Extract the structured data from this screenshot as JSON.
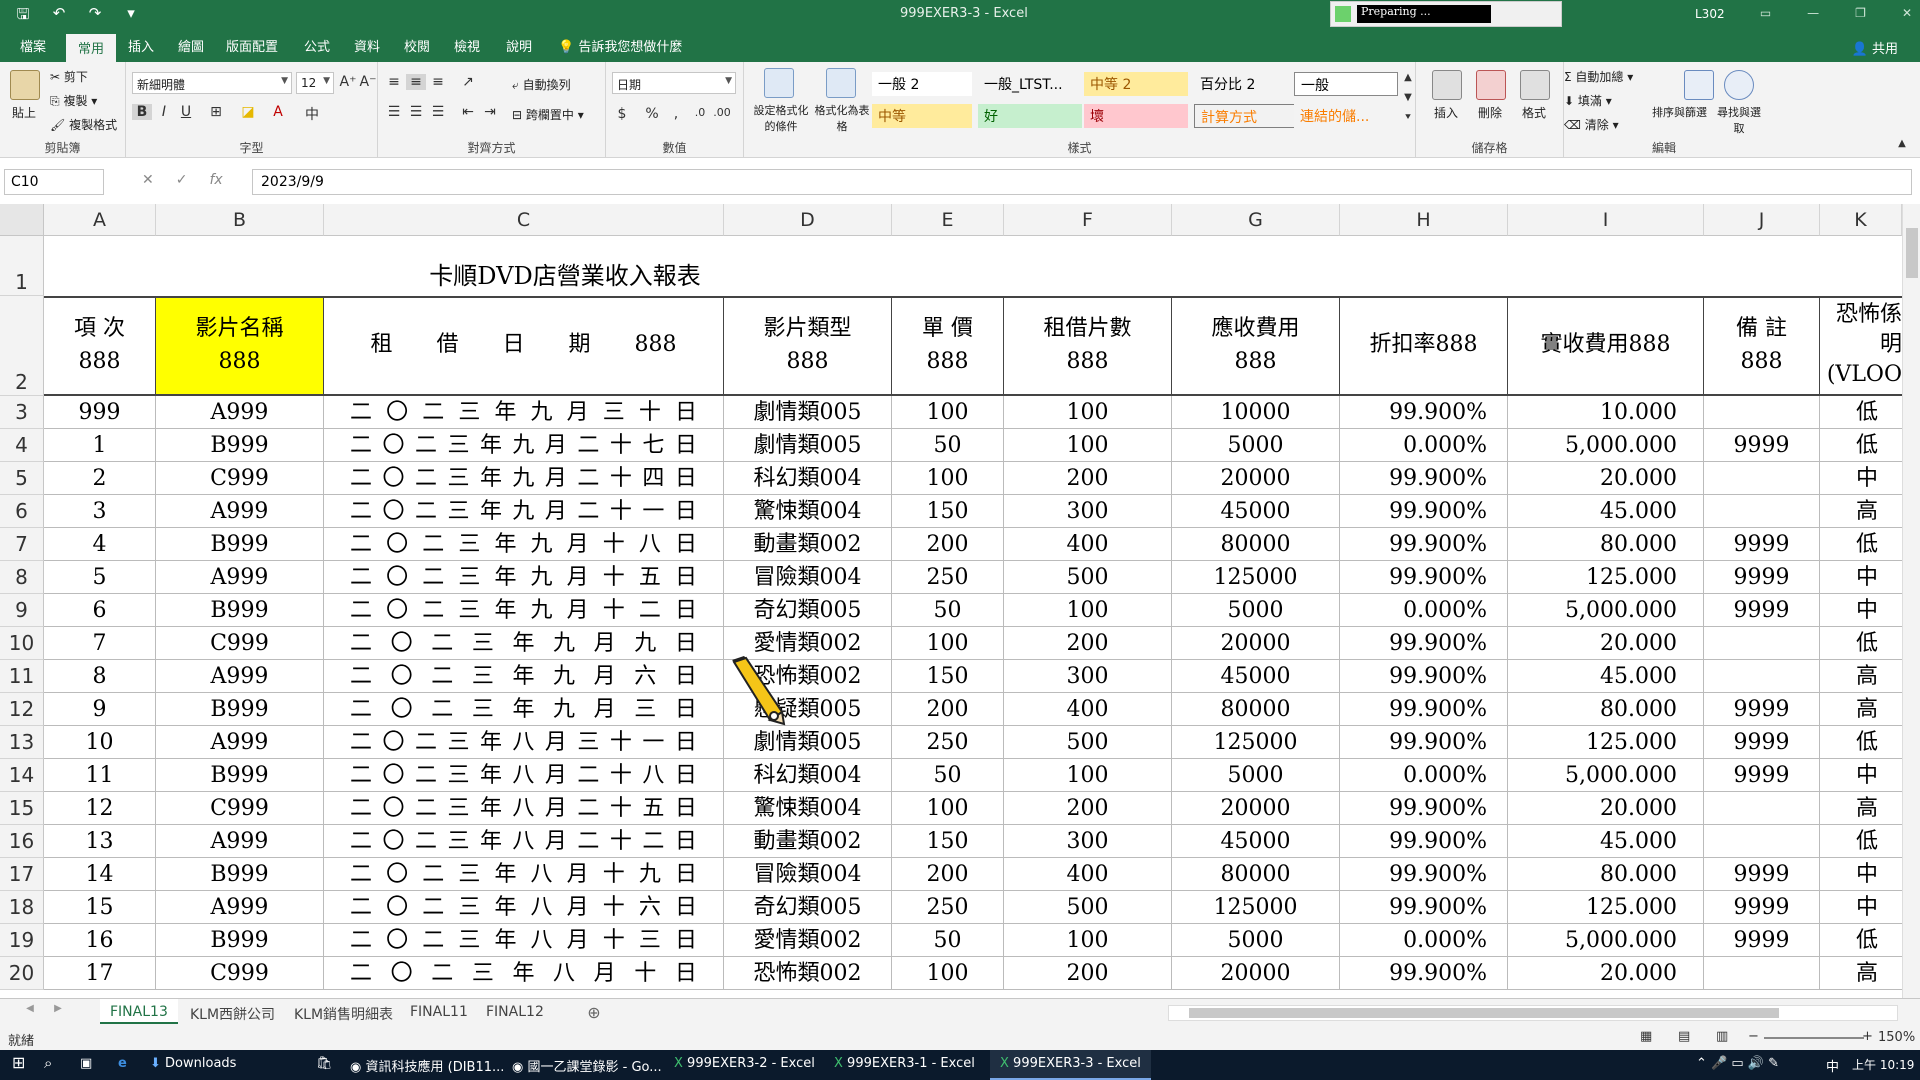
{
  "window": {
    "title": "999EXER3-3 - Excel",
    "user": "L302",
    "progress_text": "Preparing ...",
    "share": "共用"
  },
  "qat": {
    "save": "🖫",
    "undo": "↶",
    "redo": "↷",
    "customize": "▾"
  },
  "tabs": [
    "檔案",
    "常用",
    "插入",
    "繪圖",
    "版面配置",
    "公式",
    "資料",
    "校閱",
    "檢視",
    "說明"
  ],
  "tell_me": "告訴我您想做什麼",
  "ribbon": {
    "clipboard": {
      "label": "剪貼簿",
      "paste": "貼上",
      "cut": "剪下",
      "copy": "複製",
      "format_painter": "複製格式"
    },
    "font": {
      "label": "字型",
      "name": "新細明體",
      "size": "12"
    },
    "alignment": {
      "label": "對齊方式",
      "wrap": "自動換列",
      "merge": "跨欄置中"
    },
    "number": {
      "label": "數值",
      "format": "日期"
    },
    "styles": {
      "label": "樣式",
      "cond_format": "設定格式化的條件",
      "format_table": "格式化為表格",
      "cells": [
        {
          "text": "一般 2",
          "bg": "#ffffff",
          "fg": "#000000"
        },
        {
          "text": "一般_LTST...",
          "bg": "#f3f3f3",
          "fg": "#000000"
        },
        {
          "text": "中等 2",
          "bg": "#ffeb9c",
          "fg": "#9c5700"
        },
        {
          "text": "百分比 2",
          "bg": "#f3f3f3",
          "fg": "#000000"
        },
        {
          "text": "一般",
          "bg": "#ffffff",
          "fg": "#000000"
        },
        {
          "text": "中等",
          "bg": "#ffeb9c",
          "fg": "#9c5700"
        },
        {
          "text": "好",
          "bg": "#c6efce",
          "fg": "#006100"
        },
        {
          "text": "壞",
          "bg": "#ffc7ce",
          "fg": "#9c0006"
        },
        {
          "text": "計算方式",
          "bg": "#f2f2f2",
          "fg": "#fa7d00"
        },
        {
          "text": "連結的儲...",
          "bg": "#f3f3f3",
          "fg": "#fa7d00"
        }
      ]
    },
    "cells": {
      "label": "儲存格",
      "insert": "插入",
      "delete": "刪除",
      "format": "格式"
    },
    "editing": {
      "label": "編輯",
      "autosum": "自動加總",
      "fill": "填滿",
      "clear": "清除",
      "sort": "排序與篩選",
      "find": "尋找與選取"
    }
  },
  "formula_bar": {
    "name_box": "C10",
    "value": "2023/9/9",
    "fx": "fx"
  },
  "columns": [
    "A",
    "B",
    "C",
    "D",
    "E",
    "F",
    "G",
    "H",
    "I",
    "J",
    "K"
  ],
  "sheet": {
    "title": "卡順DVD店營業收入報表",
    "headers": [
      {
        "col": "A",
        "text": "項 次\n888"
      },
      {
        "col": "B",
        "text": "影片名稱\n888"
      },
      {
        "col": "C",
        "text": "租　　借　　日　　期　　888"
      },
      {
        "col": "D",
        "text": "影片類型\n888"
      },
      {
        "col": "E",
        "text": "單 價\n888"
      },
      {
        "col": "F",
        "text": "租借片數\n888"
      },
      {
        "col": "G",
        "text": "應收費用\n888"
      },
      {
        "col": "H",
        "text": "折扣率888"
      },
      {
        "col": "I",
        "text": "實收費用888"
      },
      {
        "col": "J",
        "text": "備 註\n888"
      },
      {
        "col": "K",
        "text": "恐怖係\n明\n(VLOO"
      }
    ],
    "rows": [
      {
        "n": "3",
        "a": "999",
        "b": "A999",
        "c": "二〇二三年九月三十日",
        "d": "劇情類005",
        "e": "100",
        "f": "100",
        "g": "10000",
        "h": "99.900%",
        "i": "10.000",
        "j": "",
        "k": "低"
      },
      {
        "n": "4",
        "a": "1",
        "b": "B999",
        "c": "二〇二三年九月二十七日",
        "d": "劇情類005",
        "e": "50",
        "f": "100",
        "g": "5000",
        "h": "0.000%",
        "i": "5,000.000",
        "j": "9999",
        "k": "低"
      },
      {
        "n": "5",
        "a": "2",
        "b": "C999",
        "c": "二〇二三年九月二十四日",
        "d": "科幻類004",
        "e": "100",
        "f": "200",
        "g": "20000",
        "h": "99.900%",
        "i": "20.000",
        "j": "",
        "k": "中"
      },
      {
        "n": "6",
        "a": "3",
        "b": "A999",
        "c": "二〇二三年九月二十一日",
        "d": "驚悚類004",
        "e": "150",
        "f": "300",
        "g": "45000",
        "h": "99.900%",
        "i": "45.000",
        "j": "",
        "k": "高"
      },
      {
        "n": "7",
        "a": "4",
        "b": "B999",
        "c": "二〇二三年九月十八日",
        "d": "動畫類002",
        "e": "200",
        "f": "400",
        "g": "80000",
        "h": "99.900%",
        "i": "80.000",
        "j": "9999",
        "k": "低"
      },
      {
        "n": "8",
        "a": "5",
        "b": "A999",
        "c": "二〇二三年九月十五日",
        "d": "冒險類004",
        "e": "250",
        "f": "500",
        "g": "125000",
        "h": "99.900%",
        "i": "125.000",
        "j": "9999",
        "k": "中"
      },
      {
        "n": "9",
        "a": "6",
        "b": "B999",
        "c": "二〇二三年九月十二日",
        "d": "奇幻類005",
        "e": "50",
        "f": "100",
        "g": "5000",
        "h": "0.000%",
        "i": "5,000.000",
        "j": "9999",
        "k": "中"
      },
      {
        "n": "10",
        "a": "7",
        "b": "C999",
        "c": "二〇二三年九月九日",
        "d": "愛情類002",
        "e": "100",
        "f": "200",
        "g": "20000",
        "h": "99.900%",
        "i": "20.000",
        "j": "",
        "k": "低"
      },
      {
        "n": "11",
        "a": "8",
        "b": "A999",
        "c": "二〇二三年九月六日",
        "d": "恐怖類002",
        "e": "150",
        "f": "300",
        "g": "45000",
        "h": "99.900%",
        "i": "45.000",
        "j": "",
        "k": "高"
      },
      {
        "n": "12",
        "a": "9",
        "b": "B999",
        "c": "二〇二三年九月三日",
        "d": "懸疑類005",
        "e": "200",
        "f": "400",
        "g": "80000",
        "h": "99.900%",
        "i": "80.000",
        "j": "9999",
        "k": "高"
      },
      {
        "n": "13",
        "a": "10",
        "b": "A999",
        "c": "二〇二三年八月三十一日",
        "d": "劇情類005",
        "e": "250",
        "f": "500",
        "g": "125000",
        "h": "99.900%",
        "i": "125.000",
        "j": "9999",
        "k": "低"
      },
      {
        "n": "14",
        "a": "11",
        "b": "B999",
        "c": "二〇二三年八月二十八日",
        "d": "科幻類004",
        "e": "50",
        "f": "100",
        "g": "5000",
        "h": "0.000%",
        "i": "5,000.000",
        "j": "9999",
        "k": "中"
      },
      {
        "n": "15",
        "a": "12",
        "b": "C999",
        "c": "二〇二三年八月二十五日",
        "d": "驚悚類004",
        "e": "100",
        "f": "200",
        "g": "20000",
        "h": "99.900%",
        "i": "20.000",
        "j": "",
        "k": "高"
      },
      {
        "n": "16",
        "a": "13",
        "b": "A999",
        "c": "二〇二三年八月二十二日",
        "d": "動畫類002",
        "e": "150",
        "f": "300",
        "g": "45000",
        "h": "99.900%",
        "i": "45.000",
        "j": "",
        "k": "低"
      },
      {
        "n": "17",
        "a": "14",
        "b": "B999",
        "c": "二〇二三年八月十九日",
        "d": "冒險類004",
        "e": "200",
        "f": "400",
        "g": "80000",
        "h": "99.900%",
        "i": "80.000",
        "j": "9999",
        "k": "中"
      },
      {
        "n": "18",
        "a": "15",
        "b": "A999",
        "c": "二〇二三年八月十六日",
        "d": "奇幻類005",
        "e": "250",
        "f": "500",
        "g": "125000",
        "h": "99.900%",
        "i": "125.000",
        "j": "9999",
        "k": "中"
      },
      {
        "n": "19",
        "a": "16",
        "b": "B999",
        "c": "二〇二三年八月十三日",
        "d": "愛情類002",
        "e": "50",
        "f": "100",
        "g": "5000",
        "h": "0.000%",
        "i": "5,000.000",
        "j": "9999",
        "k": "低"
      },
      {
        "n": "20",
        "a": "17",
        "b": "C999",
        "c": "二〇二三年八月十日",
        "d": "恐怖類002",
        "e": "100",
        "f": "200",
        "g": "20000",
        "h": "99.900%",
        "i": "20.000",
        "j": "",
        "k": "高"
      }
    ],
    "extra_row_numbers": [
      "1",
      "2"
    ],
    "highlight_color": "#ffff00"
  },
  "sheet_tabs": [
    "FINAL13",
    "KLM西餅公司",
    "KLM銷售明細表",
    "FINAL11",
    "FINAL12"
  ],
  "active_sheet": "FINAL13",
  "status": {
    "ready": "就緒",
    "zoom": "150%"
  },
  "taskbar": {
    "items": [
      "Downloads",
      "資訊科技應用 (DIB11...",
      "國一乙課堂錄影 - Go...",
      "999EXER3-2 - Excel",
      "999EXER3-1 - Excel",
      "999EXER3-3 - Excel"
    ],
    "ime": "中",
    "time": "上午 10:19"
  }
}
